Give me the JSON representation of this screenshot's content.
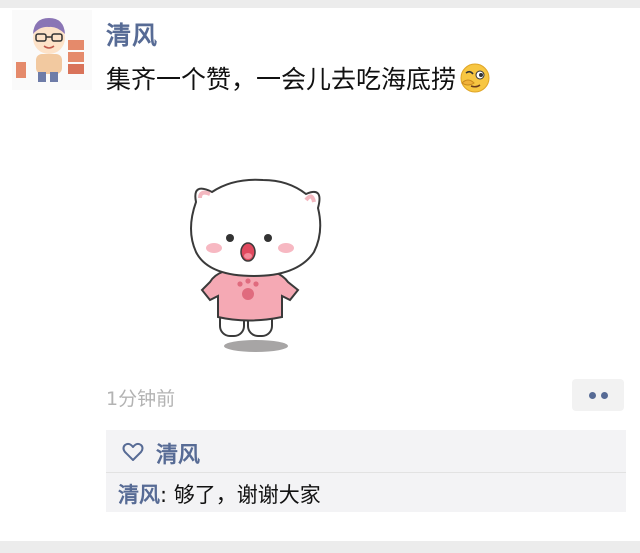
{
  "post": {
    "author": "清风",
    "text": "集齐一个赞，一会儿去吃海底捞",
    "emoji_icon": "face-with-eye-wink-icon",
    "timestamp": "1分钟前",
    "more_icon": "two-dots-icon"
  },
  "likes": {
    "icon": "heart-outline-icon",
    "names": "清风"
  },
  "comments": [
    {
      "author": "清风",
      "separator": ": ",
      "text": "够了，谢谢大家"
    }
  ],
  "colors": {
    "name_blue": "#576b95",
    "timestamp_gray": "#b3b3b3",
    "comment_bg": "#f3f3f5"
  }
}
